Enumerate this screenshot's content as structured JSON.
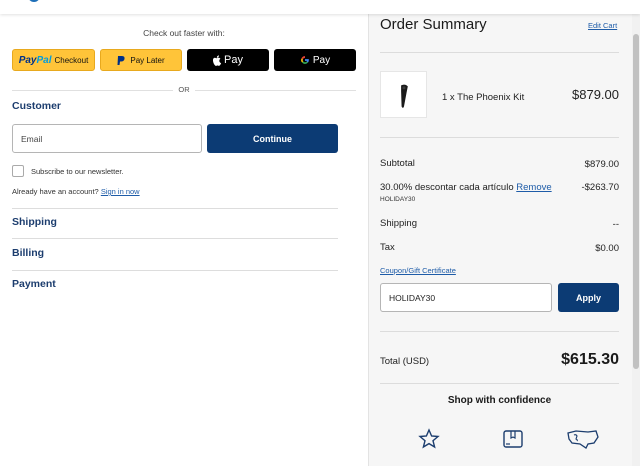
{
  "header": {
    "logo_icon": "brand-logo-icon"
  },
  "express_checkout": {
    "heading": "Check out faster with:",
    "paypal": {
      "brand_a": "Pay",
      "brand_b": "Pal",
      "label": "Checkout"
    },
    "paylater": {
      "label": "Pay Later"
    },
    "applepay": {
      "label": "Pay"
    },
    "gpay": {
      "label": "Pay"
    },
    "or": "OR"
  },
  "customer": {
    "title": "Customer",
    "email_placeholder": "Email",
    "continue_label": "Continue",
    "newsletter_label": "Subscribe to our newsletter.",
    "account_prompt": "Already have an account?",
    "signin_label": "Sign in now"
  },
  "steps": [
    {
      "label": "Shipping"
    },
    {
      "label": "Billing"
    },
    {
      "label": "Payment"
    }
  ],
  "order_summary": {
    "title": "Order Summary",
    "edit_cart": "Edit Cart",
    "item": {
      "name": "1 x The Phoenix Kit",
      "price": "$879.00"
    },
    "subtotal": {
      "label": "Subtotal",
      "value": "$879.00"
    },
    "discount": {
      "label": "30.00% descontar cada artículo",
      "remove": "Remove",
      "code": "HOLIDAY30",
      "value": "-$263.70"
    },
    "shipping": {
      "label": "Shipping",
      "value": "--"
    },
    "tax": {
      "label": "Tax",
      "value": "$0.00"
    },
    "coupon_link": "Coupon/Gift Certificate",
    "coupon_value": "HOLIDAY30",
    "apply_label": "Apply",
    "total": {
      "label": "Total (USD)",
      "value": "$615.30"
    },
    "confidence": "Shop with confidence",
    "confidence_icons": [
      "star-icon",
      "box-icon",
      "map-icon"
    ]
  },
  "colors": {
    "primary": "#0c3b74",
    "link": "#1e5ca8",
    "heading": "#1c3d6e",
    "paypal_yellow": "#ffc439"
  }
}
